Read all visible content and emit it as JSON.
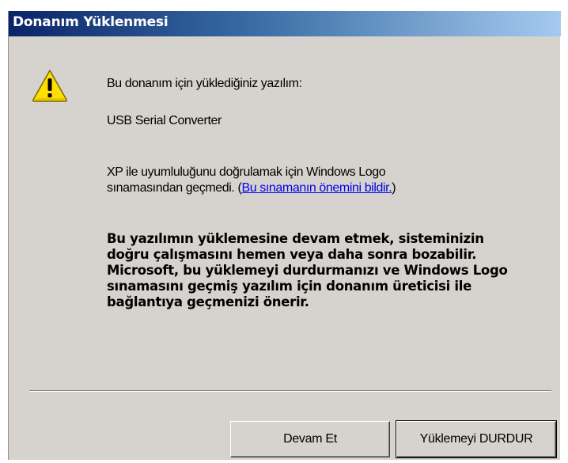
{
  "window": {
    "title": "Donanım Yüklenmesi"
  },
  "dialog": {
    "icon": "warning-icon",
    "line1": "Bu donanım için yüklediğiniz yazılım:",
    "device_name": "USB Serial Converter",
    "logo_line1": "XP ile uyumluluğunu doğrulamak için Windows Logo",
    "logo_line2_prefix": "sınamasından geçmedi. (",
    "logo_link": "Bu sınamanın önemini bildir.",
    "logo_line2_suffix": ")",
    "warning_lines": [
      "Bu yazılımın yüklemesine devam etmek, sisteminizin",
      "doğru çalışmasını hemen veya daha sonra bozabilir.",
      "Microsoft, bu yüklemeyi durdurmanızı ve Windows Logo",
      "sınamasını geçmiş yazılım için donanım üreticisi ile",
      "bağlantıya geçmenizi önerir."
    ]
  },
  "buttons": {
    "continue_label": "Devam Et",
    "stop_label": "Yüklemeyi DURDUR"
  },
  "colors": {
    "title_start": "#0a246a",
    "title_end": "#a6caf0",
    "dialog_bg": "#d6d3ce",
    "link": "#0000ee",
    "warning_icon": "#ffde00"
  }
}
